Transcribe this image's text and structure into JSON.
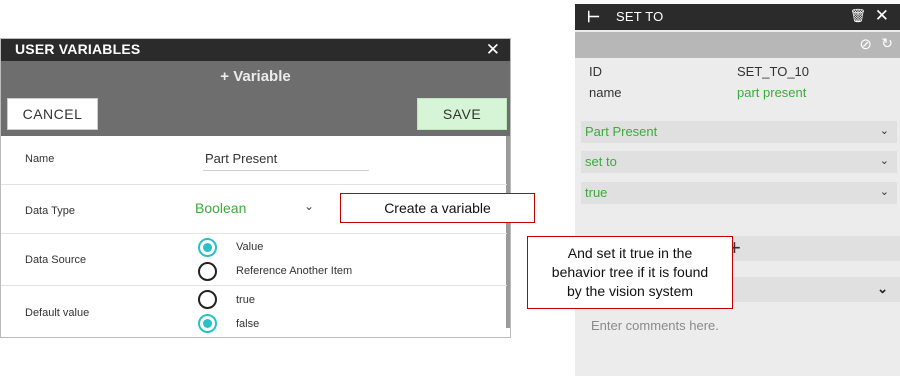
{
  "user_variables": {
    "title": "USER VARIABLES",
    "close_glyph": "✕",
    "add_variable_label": "+ Variable",
    "cancel_label": "CANCEL",
    "save_label": "SAVE",
    "fields": {
      "name": {
        "label": "Name",
        "value": "Part Present"
      },
      "data_type": {
        "label": "Data Type",
        "value": "Boolean",
        "chevron": "⌄"
      },
      "data_source": {
        "label": "Data Source",
        "options": [
          {
            "label": "Value",
            "selected": true
          },
          {
            "label": "Reference Another Item",
            "selected": false
          }
        ]
      },
      "default_value": {
        "label": "Default value",
        "options": [
          {
            "label": "true",
            "selected": false
          },
          {
            "label": "false",
            "selected": true
          }
        ]
      }
    }
  },
  "callouts": {
    "create_variable": "Create a variable",
    "set_true": [
      "And set it true in the",
      "behavior tree if it is found",
      "by the vision system"
    ]
  },
  "set_to_panel": {
    "back_glyph": "⊢",
    "title": "SET TO",
    "trash_icon": "🗑",
    "close_glyph": "✕",
    "disable_glyph": "⊘",
    "refresh_glyph": "↻",
    "id_key": "ID",
    "id_value": "SET_TO_10",
    "name_key": "name",
    "name_value": "part present",
    "dropdowns": [
      {
        "value": "Part Present",
        "chevron": "⌄"
      },
      {
        "value": "set to",
        "chevron": "⌄"
      },
      {
        "value": "true",
        "chevron": "⌄"
      }
    ],
    "add_glyph": "+",
    "collapse_chevron": "⌄",
    "comments_placeholder": "Enter comments here."
  },
  "colors": {
    "accent_green": "#3caa3c",
    "radio_teal": "#29c0c7",
    "save_bg": "#d6f5d6",
    "titlebar": "#2b2b2b",
    "callout_border": "#c00000"
  }
}
